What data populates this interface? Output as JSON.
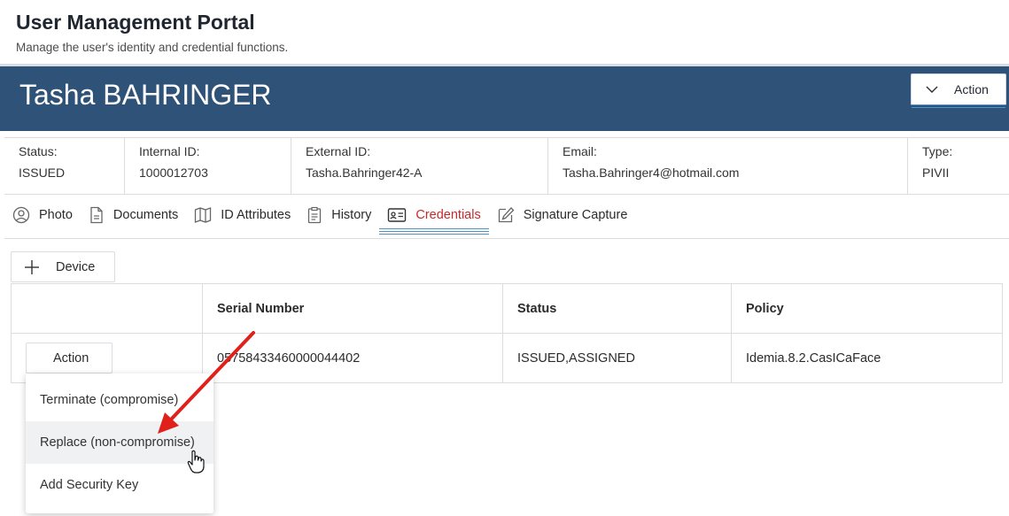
{
  "header": {
    "title": "User Management Portal",
    "subtitle": "Manage the user's identity and credential functions."
  },
  "banner": {
    "user_name": "Tasha BAHRINGER",
    "action_label": "Action"
  },
  "info": [
    {
      "label": "Status:",
      "value": "ISSUED"
    },
    {
      "label": "Internal ID:",
      "value": "1000012703"
    },
    {
      "label": "External ID:",
      "value": "Tasha.Bahringer42-A"
    },
    {
      "label": "Email:",
      "value": "Tasha.Bahringer4@hotmail.com"
    },
    {
      "label": "Type:",
      "value": "PIVII"
    }
  ],
  "tabs": [
    {
      "label": "Photo",
      "icon": "person-circle-icon"
    },
    {
      "label": "Documents",
      "icon": "document-icon"
    },
    {
      "label": "ID Attributes",
      "icon": "map-icon"
    },
    {
      "label": "History",
      "icon": "clipboard-icon"
    },
    {
      "label": "Credentials",
      "icon": "id-card-icon",
      "active": true
    },
    {
      "label": "Signature Capture",
      "icon": "pen-icon"
    }
  ],
  "device_button": "Device",
  "table": {
    "headers": [
      "",
      "Serial Number",
      "Status",
      "Policy"
    ],
    "rows": [
      {
        "action": "Action",
        "serial": "05758433460000044402",
        "status": "ISSUED,ASSIGNED",
        "policy": "Idemia.8.2.CasICaFace"
      }
    ]
  },
  "dropdown": {
    "items": [
      "Terminate (compromise)",
      "Replace (non-compromise)",
      "Add Security Key"
    ],
    "hovered_index": 1
  },
  "colors": {
    "banner": "#2f5278",
    "active_tab": "#c6282a",
    "accent_line": "#4e92c8",
    "annotation_arrow": "#e0201b"
  }
}
